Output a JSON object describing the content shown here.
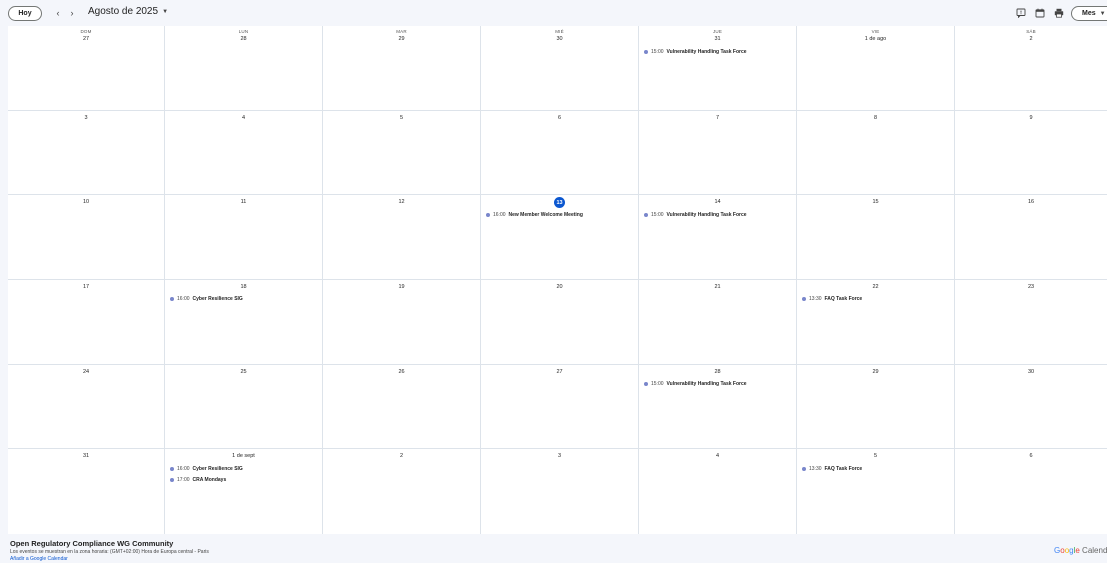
{
  "toolbar": {
    "today_label": "Hoy",
    "prev_icon": "‹",
    "next_icon": "›",
    "month_label": "Agosto de 2025",
    "view_label": "Mes"
  },
  "weekdays": [
    "DOM",
    "LUN",
    "MAR",
    "MIÉ",
    "JUE",
    "VIE",
    "SÁB"
  ],
  "weeks": [
    [
      {
        "day": "27"
      },
      {
        "day": "28"
      },
      {
        "day": "29"
      },
      {
        "day": "30"
      },
      {
        "day": "31",
        "events": [
          {
            "time": "15:00",
            "title": "Vulnerability Handling Task Force"
          }
        ]
      },
      {
        "day": "1 de ago"
      },
      {
        "day": "2"
      }
    ],
    [
      {
        "day": "3"
      },
      {
        "day": "4"
      },
      {
        "day": "5"
      },
      {
        "day": "6"
      },
      {
        "day": "7"
      },
      {
        "day": "8"
      },
      {
        "day": "9"
      }
    ],
    [
      {
        "day": "10"
      },
      {
        "day": "11"
      },
      {
        "day": "12"
      },
      {
        "day": "13",
        "today": true,
        "events": [
          {
            "time": "16:00",
            "title": "New Member Welcome Meeting"
          }
        ]
      },
      {
        "day": "14",
        "events": [
          {
            "time": "15:00",
            "title": "Vulnerability Handling Task Force"
          }
        ]
      },
      {
        "day": "15"
      },
      {
        "day": "16"
      }
    ],
    [
      {
        "day": "17"
      },
      {
        "day": "18",
        "events": [
          {
            "time": "16:00",
            "title": "Cyber Resilience SIG"
          }
        ]
      },
      {
        "day": "19"
      },
      {
        "day": "20"
      },
      {
        "day": "21"
      },
      {
        "day": "22",
        "events": [
          {
            "time": "13:30",
            "title": "FAQ Task Force"
          }
        ]
      },
      {
        "day": "23"
      }
    ],
    [
      {
        "day": "24"
      },
      {
        "day": "25"
      },
      {
        "day": "26"
      },
      {
        "day": "27"
      },
      {
        "day": "28",
        "events": [
          {
            "time": "15:00",
            "title": "Vulnerability Handling Task Force"
          }
        ]
      },
      {
        "day": "29"
      },
      {
        "day": "30"
      }
    ],
    [
      {
        "day": "31"
      },
      {
        "day": "1 de sept",
        "events": [
          {
            "time": "16:00",
            "title": "Cyber Resilience SIG"
          },
          {
            "time": "17:00",
            "title": "CRA Mondays"
          }
        ]
      },
      {
        "day": "2"
      },
      {
        "day": "3"
      },
      {
        "day": "4"
      },
      {
        "day": "5",
        "events": [
          {
            "time": "13:30",
            "title": "FAQ Task Force"
          }
        ]
      },
      {
        "day": "6"
      }
    ]
  ],
  "footer": {
    "calendar_name": "Open Regulatory Compliance WG Community",
    "timezone_note": "Los eventos se muestran en la zona horaria: (GMT+02:00) Hora de Europa central - Paris",
    "add_link": "Añadir a Google Calendar",
    "logo_text": "Google Calendar"
  },
  "colors": {
    "event_dot": "#7986cb",
    "today_circle": "#0b57d0",
    "link": "#0b57d0",
    "background": "#f4f6fb"
  },
  "icons": {
    "feedback": "feedback-icon",
    "calendar": "calendar-icon",
    "print": "print-icon",
    "view_caret": "caret-down-icon"
  }
}
